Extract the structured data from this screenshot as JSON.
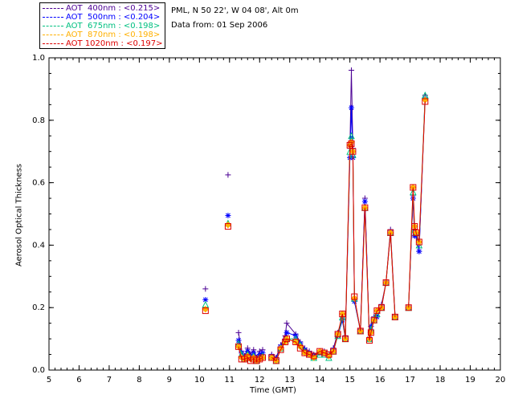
{
  "info": {
    "location": "PML, N 50 22', W 04 08', Alt 0m",
    "date": "Data from: 01 Sep 2006"
  },
  "legend": [
    {
      "label": "AOT  400nm : <0.215>",
      "color": "#4b0094"
    },
    {
      "label": "AOT  500nm : <0.204>",
      "color": "#0000ff"
    },
    {
      "label": "AOT  675nm : <0.198>",
      "color": "#00c080"
    },
    {
      "label": "AOT  870nm : <0.198>",
      "color": "#ffb000"
    },
    {
      "label": "AOT 1020nm : <0.197>",
      "color": "#dd0000"
    }
  ],
  "chart_data": {
    "type": "scatter",
    "xlabel": "Time (GMT)",
    "ylabel": "Aerosol Optical Thickness",
    "xlim": [
      5,
      20
    ],
    "ylim": [
      0,
      1.0
    ],
    "xticks": [
      "5",
      "6",
      "7",
      "8",
      "9",
      "10",
      "11",
      "12",
      "13",
      "14",
      "15",
      "16",
      "17",
      "18",
      "19",
      "20"
    ],
    "yticks": [
      "0.0",
      "0.2",
      "0.4",
      "0.6",
      "0.8",
      "1.0"
    ],
    "grid": false,
    "legend_position": "top-left outside",
    "series": [
      {
        "name": "AOT  400nm : <0.215>",
        "color": "#4b0094",
        "marker": "plus",
        "points": [
          [
            10.2,
            0.26
          ],
          [
            10.95,
            0.625
          ],
          [
            11.3,
            0.12
          ],
          [
            11.4,
            0.06
          ],
          [
            11.5,
            0.045
          ],
          [
            11.6,
            0.07
          ],
          [
            11.7,
            0.05
          ],
          [
            11.8,
            0.065
          ],
          [
            11.9,
            0.04
          ],
          [
            12.0,
            0.06
          ],
          [
            12.1,
            0.065
          ],
          [
            12.4,
            0.05
          ],
          [
            12.55,
            0.04
          ],
          [
            12.7,
            0.08
          ],
          [
            12.85,
            0.11
          ],
          [
            12.9,
            0.15
          ],
          [
            13.2,
            0.115
          ],
          [
            13.35,
            0.09
          ],
          [
            13.5,
            0.07
          ],
          [
            13.65,
            0.06
          ],
          [
            13.8,
            0.05
          ],
          [
            14.0,
            0.06
          ],
          [
            14.15,
            0.06
          ],
          [
            14.3,
            0.05
          ],
          [
            14.45,
            0.07
          ],
          [
            14.6,
            0.12
          ],
          [
            14.75,
            0.17
          ],
          [
            14.85,
            0.11
          ],
          [
            15.0,
            0.71
          ],
          [
            15.05,
            0.96
          ],
          [
            15.1,
            0.71
          ],
          [
            15.15,
            0.22
          ],
          [
            15.35,
            0.13
          ],
          [
            15.5,
            0.55
          ],
          [
            15.65,
            0.1
          ],
          [
            15.7,
            0.14
          ],
          [
            15.8,
            0.17
          ],
          [
            15.9,
            0.19
          ],
          [
            16.05,
            0.21
          ],
          [
            16.2,
            0.28
          ],
          [
            16.35,
            0.45
          ],
          [
            16.5,
            0.175
          ],
          [
            16.95,
            0.2
          ],
          [
            17.1,
            0.56
          ],
          [
            17.15,
            0.43
          ],
          [
            17.2,
            0.43
          ],
          [
            17.3,
            0.38
          ],
          [
            17.5,
            0.88
          ]
        ]
      },
      {
        "name": "AOT  500nm : <0.204>",
        "color": "#0000ff",
        "marker": "asterisk",
        "points": [
          [
            10.2,
            0.225
          ],
          [
            10.95,
            0.495
          ],
          [
            11.3,
            0.095
          ],
          [
            11.4,
            0.055
          ],
          [
            11.5,
            0.04
          ],
          [
            11.6,
            0.06
          ],
          [
            11.7,
            0.045
          ],
          [
            11.8,
            0.055
          ],
          [
            11.9,
            0.035
          ],
          [
            12.0,
            0.05
          ],
          [
            12.1,
            0.055
          ],
          [
            12.4,
            0.045
          ],
          [
            12.55,
            0.035
          ],
          [
            12.7,
            0.075
          ],
          [
            12.85,
            0.1
          ],
          [
            12.9,
            0.12
          ],
          [
            13.2,
            0.11
          ],
          [
            13.35,
            0.085
          ],
          [
            13.5,
            0.065
          ],
          [
            13.65,
            0.055
          ],
          [
            13.8,
            0.045
          ],
          [
            14.0,
            0.055
          ],
          [
            14.15,
            0.055
          ],
          [
            14.3,
            0.045
          ],
          [
            14.45,
            0.065
          ],
          [
            14.6,
            0.11
          ],
          [
            14.75,
            0.16
          ],
          [
            14.85,
            0.1
          ],
          [
            15.0,
            0.68
          ],
          [
            15.05,
            0.84
          ],
          [
            15.1,
            0.68
          ],
          [
            15.15,
            0.22
          ],
          [
            15.35,
            0.125
          ],
          [
            15.5,
            0.54
          ],
          [
            15.65,
            0.1
          ],
          [
            15.7,
            0.14
          ],
          [
            15.8,
            0.165
          ],
          [
            15.9,
            0.17
          ],
          [
            16.05,
            0.2
          ],
          [
            16.2,
            0.28
          ],
          [
            16.35,
            0.44
          ],
          [
            16.5,
            0.17
          ],
          [
            16.95,
            0.2
          ],
          [
            17.1,
            0.55
          ],
          [
            17.15,
            0.43
          ],
          [
            17.2,
            0.43
          ],
          [
            17.3,
            0.38
          ],
          [
            17.5,
            0.87
          ]
        ]
      },
      {
        "name": "AOT  675nm : <0.198>",
        "color": "#00c080",
        "marker": "triangle",
        "points": [
          [
            10.2,
            0.21
          ],
          [
            10.95,
            0.47
          ],
          [
            11.3,
            0.085
          ],
          [
            11.4,
            0.05
          ],
          [
            11.5,
            0.035
          ],
          [
            11.6,
            0.05
          ],
          [
            11.7,
            0.04
          ],
          [
            11.8,
            0.045
          ],
          [
            11.9,
            0.03
          ],
          [
            12.0,
            0.04
          ],
          [
            12.1,
            0.045
          ],
          [
            12.4,
            0.04
          ],
          [
            12.55,
            0.03
          ],
          [
            12.7,
            0.07
          ],
          [
            12.85,
            0.095
          ],
          [
            12.9,
            0.1
          ],
          [
            13.2,
            0.1
          ],
          [
            13.35,
            0.08
          ],
          [
            13.5,
            0.06
          ],
          [
            13.65,
            0.05
          ],
          [
            13.8,
            0.04
          ],
          [
            14.0,
            0.05
          ],
          [
            14.15,
            0.05
          ],
          [
            14.3,
            0.04
          ],
          [
            14.45,
            0.06
          ],
          [
            14.6,
            0.11
          ],
          [
            14.75,
            0.17
          ],
          [
            14.85,
            0.1
          ],
          [
            15.0,
            0.7
          ],
          [
            15.05,
            0.75
          ],
          [
            15.1,
            0.69
          ],
          [
            15.15,
            0.23
          ],
          [
            15.35,
            0.125
          ],
          [
            15.5,
            0.52
          ],
          [
            15.65,
            0.1
          ],
          [
            15.7,
            0.13
          ],
          [
            15.8,
            0.16
          ],
          [
            15.9,
            0.18
          ],
          [
            16.05,
            0.2
          ],
          [
            16.2,
            0.28
          ],
          [
            16.35,
            0.44
          ],
          [
            16.5,
            0.17
          ],
          [
            16.95,
            0.2
          ],
          [
            17.1,
            0.57
          ],
          [
            17.15,
            0.45
          ],
          [
            17.2,
            0.44
          ],
          [
            17.3,
            0.4
          ],
          [
            17.5,
            0.88
          ]
        ]
      },
      {
        "name": "AOT  870nm : <0.198>",
        "color": "#ffb000",
        "marker": "diamond",
        "points": [
          [
            10.2,
            0.195
          ],
          [
            10.95,
            0.465
          ],
          [
            11.3,
            0.075
          ],
          [
            11.4,
            0.04
          ],
          [
            11.5,
            0.035
          ],
          [
            11.6,
            0.045
          ],
          [
            11.7,
            0.035
          ],
          [
            11.8,
            0.04
          ],
          [
            11.9,
            0.03
          ],
          [
            12.0,
            0.035
          ],
          [
            12.1,
            0.04
          ],
          [
            12.4,
            0.04
          ],
          [
            12.55,
            0.03
          ],
          [
            12.7,
            0.07
          ],
          [
            12.85,
            0.09
          ],
          [
            12.9,
            0.1
          ],
          [
            13.2,
            0.09
          ],
          [
            13.35,
            0.075
          ],
          [
            13.5,
            0.055
          ],
          [
            13.65,
            0.05
          ],
          [
            13.8,
            0.04
          ],
          [
            14.0,
            0.06
          ],
          [
            14.15,
            0.055
          ],
          [
            14.3,
            0.045
          ],
          [
            14.45,
            0.06
          ],
          [
            14.6,
            0.115
          ],
          [
            14.75,
            0.18
          ],
          [
            14.85,
            0.1
          ],
          [
            15.0,
            0.72
          ],
          [
            15.05,
            0.73
          ],
          [
            15.1,
            0.7
          ],
          [
            15.15,
            0.23
          ],
          [
            15.35,
            0.125
          ],
          [
            15.5,
            0.52
          ],
          [
            15.65,
            0.1
          ],
          [
            15.7,
            0.12
          ],
          [
            15.8,
            0.16
          ],
          [
            15.9,
            0.19
          ],
          [
            16.05,
            0.2
          ],
          [
            16.2,
            0.28
          ],
          [
            16.35,
            0.44
          ],
          [
            16.5,
            0.17
          ],
          [
            16.95,
            0.2
          ],
          [
            17.1,
            0.585
          ],
          [
            17.15,
            0.46
          ],
          [
            17.2,
            0.44
          ],
          [
            17.3,
            0.41
          ],
          [
            17.5,
            0.865
          ]
        ]
      },
      {
        "name": "AOT 1020nm : <0.197>",
        "color": "#dd0000",
        "marker": "square",
        "points": [
          [
            10.2,
            0.19
          ],
          [
            10.95,
            0.46
          ],
          [
            11.3,
            0.075
          ],
          [
            11.4,
            0.035
          ],
          [
            11.5,
            0.035
          ],
          [
            11.6,
            0.04
          ],
          [
            11.7,
            0.03
          ],
          [
            11.8,
            0.035
          ],
          [
            11.9,
            0.03
          ],
          [
            12.0,
            0.035
          ],
          [
            12.1,
            0.04
          ],
          [
            12.4,
            0.04
          ],
          [
            12.55,
            0.03
          ],
          [
            12.7,
            0.065
          ],
          [
            12.85,
            0.09
          ],
          [
            12.9,
            0.1
          ],
          [
            13.2,
            0.09
          ],
          [
            13.35,
            0.07
          ],
          [
            13.5,
            0.055
          ],
          [
            13.65,
            0.05
          ],
          [
            13.8,
            0.045
          ],
          [
            14.0,
            0.06
          ],
          [
            14.15,
            0.055
          ],
          [
            14.3,
            0.05
          ],
          [
            14.45,
            0.06
          ],
          [
            14.6,
            0.115
          ],
          [
            14.75,
            0.18
          ],
          [
            14.85,
            0.1
          ],
          [
            15.0,
            0.72
          ],
          [
            15.05,
            0.725
          ],
          [
            15.1,
            0.7
          ],
          [
            15.15,
            0.235
          ],
          [
            15.35,
            0.125
          ],
          [
            15.5,
            0.52
          ],
          [
            15.65,
            0.095
          ],
          [
            15.7,
            0.12
          ],
          [
            15.8,
            0.16
          ],
          [
            15.9,
            0.19
          ],
          [
            16.05,
            0.2
          ],
          [
            16.2,
            0.28
          ],
          [
            16.35,
            0.44
          ],
          [
            16.5,
            0.17
          ],
          [
            16.95,
            0.2
          ],
          [
            17.1,
            0.585
          ],
          [
            17.15,
            0.46
          ],
          [
            17.2,
            0.44
          ],
          [
            17.3,
            0.41
          ],
          [
            17.5,
            0.86
          ]
        ]
      }
    ]
  }
}
